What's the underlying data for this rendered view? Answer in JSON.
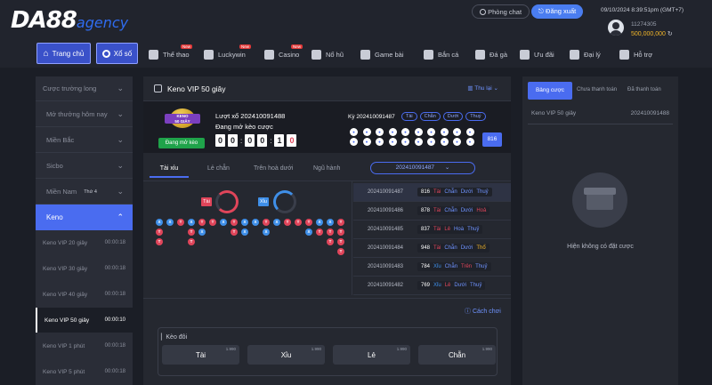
{
  "header": {
    "logo_main": "DA88",
    "logo_suffix": "agency",
    "chat_label": "Phòng chat",
    "logout_label": "Đăng xuất",
    "datetime": "09/10/2024 8:39:51pm",
    "timezone": "(GMT+7)",
    "user_id": "11274305",
    "balance": "500,000,000"
  },
  "nav": {
    "home": "Trang chủ",
    "lottery": "Xổ số",
    "items": [
      {
        "label": "Thể thao",
        "icon": "sports-icon",
        "hot": "New"
      },
      {
        "label": "Luckywin",
        "icon": "luckywin-icon",
        "hot": "New"
      },
      {
        "label": "Casino",
        "icon": "casino-icon",
        "hot": "New"
      },
      {
        "label": "Nổ hũ",
        "icon": "slots-icon",
        "hot": ""
      },
      {
        "label": "Game bài",
        "icon": "cards-icon",
        "hot": ""
      },
      {
        "label": "Bắn cá",
        "icon": "fish-icon",
        "hot": ""
      },
      {
        "label": "Đá gà",
        "icon": "cockfight-icon",
        "hot": ""
      },
      {
        "label": "Ưu đãi",
        "icon": "gift-icon",
        "hot": ""
      },
      {
        "label": "Đại lý",
        "icon": "agent-icon",
        "hot": ""
      },
      {
        "label": "Hỗ trợ",
        "icon": "support-icon",
        "hot": ""
      }
    ]
  },
  "sidebar": {
    "categories": [
      "Cược trường long",
      "Mở thưởng hôm nay",
      "Miền Bắc",
      "Sicbo",
      "Miền Nam"
    ],
    "mien_nam_day": "Thứ 4",
    "active_group": "Keno",
    "games": [
      {
        "name": "Keno VIP 20 giây",
        "time": "00:00:18"
      },
      {
        "name": "Keno VIP 30 giây",
        "time": "00:00:18"
      },
      {
        "name": "Keno VIP 40 giây",
        "time": "00:00:18"
      },
      {
        "name": "Keno VIP 50 giây",
        "time": "00:00:10"
      },
      {
        "name": "Keno VIP 1 phút",
        "time": "00:00:18"
      },
      {
        "name": "Keno VIP 5 phút",
        "time": "00:00:18"
      }
    ]
  },
  "main": {
    "title": "Keno VIP 50 giây",
    "collapse_label": "Thu lại",
    "game_badge": "KENO",
    "game_badge_sub": "50 GIÂY",
    "open_label": "Đang mở kèo",
    "draw_label": "Lượt xổ 202410091488",
    "draw_status": "Đang mở kèo cược",
    "countdown": [
      "0",
      "0",
      "0",
      "0",
      "1",
      "0"
    ],
    "prev_label": "Kỳ 202410091487",
    "prev_tags": [
      "Tài",
      "Chẵn",
      "Dưới",
      "Thuỷ"
    ],
    "prev_sum": "816",
    "tabs": [
      "Tài xỉu",
      "Lẻ chẵn",
      "Trên hoà dưới",
      "Ngũ hành"
    ],
    "period_select": "202410091487",
    "stat_tai": "Tài",
    "stat_xiu": "Xỉu",
    "rules_label": "Cách chơi",
    "bet_title": "Kèo đôi",
    "bet_options": [
      {
        "label": "Tài",
        "odd": "1.990"
      },
      {
        "label": "Xỉu",
        "odd": "1.990"
      },
      {
        "label": "Lẻ",
        "odd": "1.990"
      },
      {
        "label": "Chẵn",
        "odd": "1.990"
      }
    ],
    "results": [
      {
        "id": "202410091487",
        "sum": "816",
        "tags": [
          "Tài",
          "Chẵn",
          "Dưới",
          "Thuỷ"
        ]
      },
      {
        "id": "202410091486",
        "sum": "878",
        "tags": [
          "Tài",
          "Chẵn",
          "Dưới",
          "Hoả"
        ]
      },
      {
        "id": "202410091485",
        "sum": "837",
        "tags": [
          "Tài",
          "Lẻ",
          "Hoà",
          "Thuỷ"
        ]
      },
      {
        "id": "202410091484",
        "sum": "948",
        "tags": [
          "Tài",
          "Chẵn",
          "Dưới",
          "Thổ"
        ]
      },
      {
        "id": "202410091483",
        "sum": "784",
        "tags": [
          "Xỉu",
          "Chẵn",
          "Trên",
          "Thuỷ"
        ]
      },
      {
        "id": "202410091482",
        "sum": "769",
        "tags": [
          "Xỉu",
          "Lẻ",
          "Dưới",
          "Thuỷ"
        ]
      }
    ]
  },
  "right": {
    "tabs": [
      "Bảng cược",
      "Chưa thanh toán",
      "Đã thanh toán"
    ],
    "game": "Keno VIP 50 giây",
    "draw_id": "202410091488",
    "empty_text": "Hiện không có đặt cược"
  }
}
